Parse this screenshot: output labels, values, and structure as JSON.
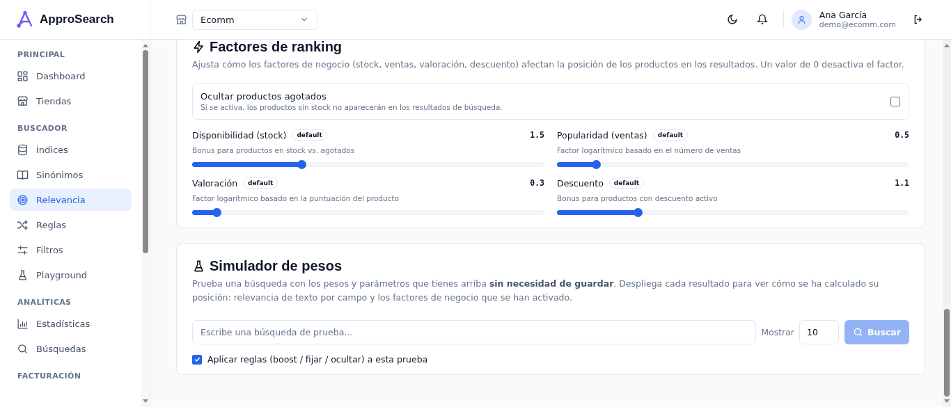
{
  "brand": {
    "name": "ApproSearch"
  },
  "header": {
    "store_select": {
      "value": "Ecomm"
    },
    "user": {
      "name": "Ana García",
      "email": "demo@ecomm.com"
    }
  },
  "sidebar": {
    "sections": [
      {
        "title": "PRINCIPAL",
        "items": [
          {
            "label": "Dashboard",
            "selected": false
          },
          {
            "label": "Tiendas",
            "selected": false
          }
        ]
      },
      {
        "title": "BUSCADOR",
        "items": [
          {
            "label": "Índices",
            "selected": false
          },
          {
            "label": "Sinónimos",
            "selected": false
          },
          {
            "label": "Relevancia",
            "selected": true
          },
          {
            "label": "Reglas",
            "selected": false
          },
          {
            "label": "Filtros",
            "selected": false
          },
          {
            "label": "Playground",
            "selected": false
          }
        ]
      },
      {
        "title": "ANALÍTICAS",
        "items": [
          {
            "label": "Estadísticas",
            "selected": false
          },
          {
            "label": "Búsquedas",
            "selected": false
          }
        ]
      },
      {
        "title": "FACTURACIÓN"
      }
    ]
  },
  "ranking": {
    "title": "Factores de ranking",
    "description": "Ajusta cómo los factores de negocio (stock, ventas, valoración, descuento) afectan la posición de los productos en los resultados. Un valor de 0 desactiva el factor.",
    "hide_out_of_stock": {
      "label": "Ocultar productos agotados",
      "hint": "Si se activa, los productos sin stock no aparecerán en los resultados de búsqueda.",
      "checked": false
    },
    "factors": [
      {
        "name": "Disponibilidad (stock)",
        "badge": "default",
        "reading": "1.5",
        "hint": "Bonus para productos en stock vs. agotados",
        "level": 0.31
      },
      {
        "name": "Popularidad (ventas)",
        "badge": "default",
        "reading": "0.5",
        "hint": "Factor logarítmico basado en el número de ventas",
        "level": 0.11
      },
      {
        "name": "Valoración",
        "badge": "default",
        "reading": "0.3",
        "hint": "Factor logarítmico basado en la puntuación del producto",
        "level": 0.07
      },
      {
        "name": "Descuento",
        "badge": "default",
        "reading": "1.1",
        "hint": "Bonus para productos con descuento activo",
        "level": 0.23
      }
    ]
  },
  "simulator": {
    "title": "Simulador de pesos",
    "description": "Prueba una búsqueda con los pesos y parámetros que tienes arriba **sin necesidad de guardar**. Despliega cada resultado para ver cómo se ha calculado su posición: relevancia de texto por campo y los factores de negocio que se han activado.",
    "query": {
      "placeholder": "Escribe una búsqueda de prueba..."
    },
    "show_label": "Mostrar",
    "show_count": "10",
    "search_button": {
      "label": "Buscar",
      "disabled": true
    },
    "apply_rules": {
      "label": "Aplicar reglas (boost / fijar / ocultar) a esta prueba",
      "checked": true
    }
  }
}
